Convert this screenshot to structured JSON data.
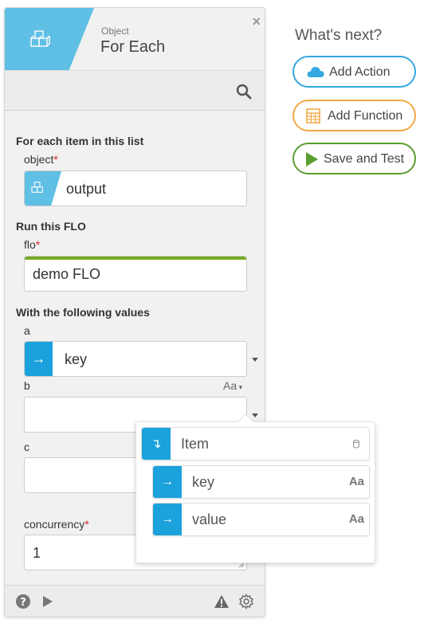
{
  "header": {
    "type_label": "Object",
    "title": "For Each",
    "close_glyph": "×"
  },
  "sections": {
    "list_title": "For each item in this list",
    "flo_title": "Run this FLO",
    "values_title": "With the following values"
  },
  "fields": {
    "object": {
      "label": "object",
      "required_mark": "*",
      "value": "output"
    },
    "flo": {
      "label": "flo",
      "required_mark": "*",
      "value": "demo FLO"
    },
    "a": {
      "label": "a",
      "value": "key"
    },
    "b": {
      "label": "b",
      "value": "",
      "type_toggle": "Aa"
    },
    "c": {
      "label": "c",
      "value": ""
    },
    "concurrency": {
      "label": "concurrency",
      "required_mark": "*",
      "value": "1"
    }
  },
  "whats_next": {
    "title": "What's next?",
    "buttons": [
      {
        "label": "Add Action",
        "icon": "cloud-icon",
        "color": "#33a8e0"
      },
      {
        "label": "Add Function",
        "icon": "calculator-icon",
        "color": "#f3a847"
      },
      {
        "label": "Save and Test",
        "icon": "play-icon",
        "color": "#5a9e2f"
      }
    ]
  },
  "popup": {
    "root": {
      "label": "Item",
      "icon": "return-arrow-icon",
      "trailing_icon": "database-icon"
    },
    "children": [
      {
        "label": "key",
        "type": "Aa",
        "icon": "arrow-right-icon"
      },
      {
        "label": "value",
        "type": "Aa",
        "icon": "arrow-right-icon"
      }
    ]
  },
  "footer": {
    "icons": [
      "help-icon",
      "play-icon",
      "warning-icon",
      "settings-icon"
    ]
  },
  "colors": {
    "header_blue": "#5fbfe4",
    "chip_blue": "#1ba1dc",
    "required_red": "#d9242b",
    "flo_green": "#75a925"
  }
}
